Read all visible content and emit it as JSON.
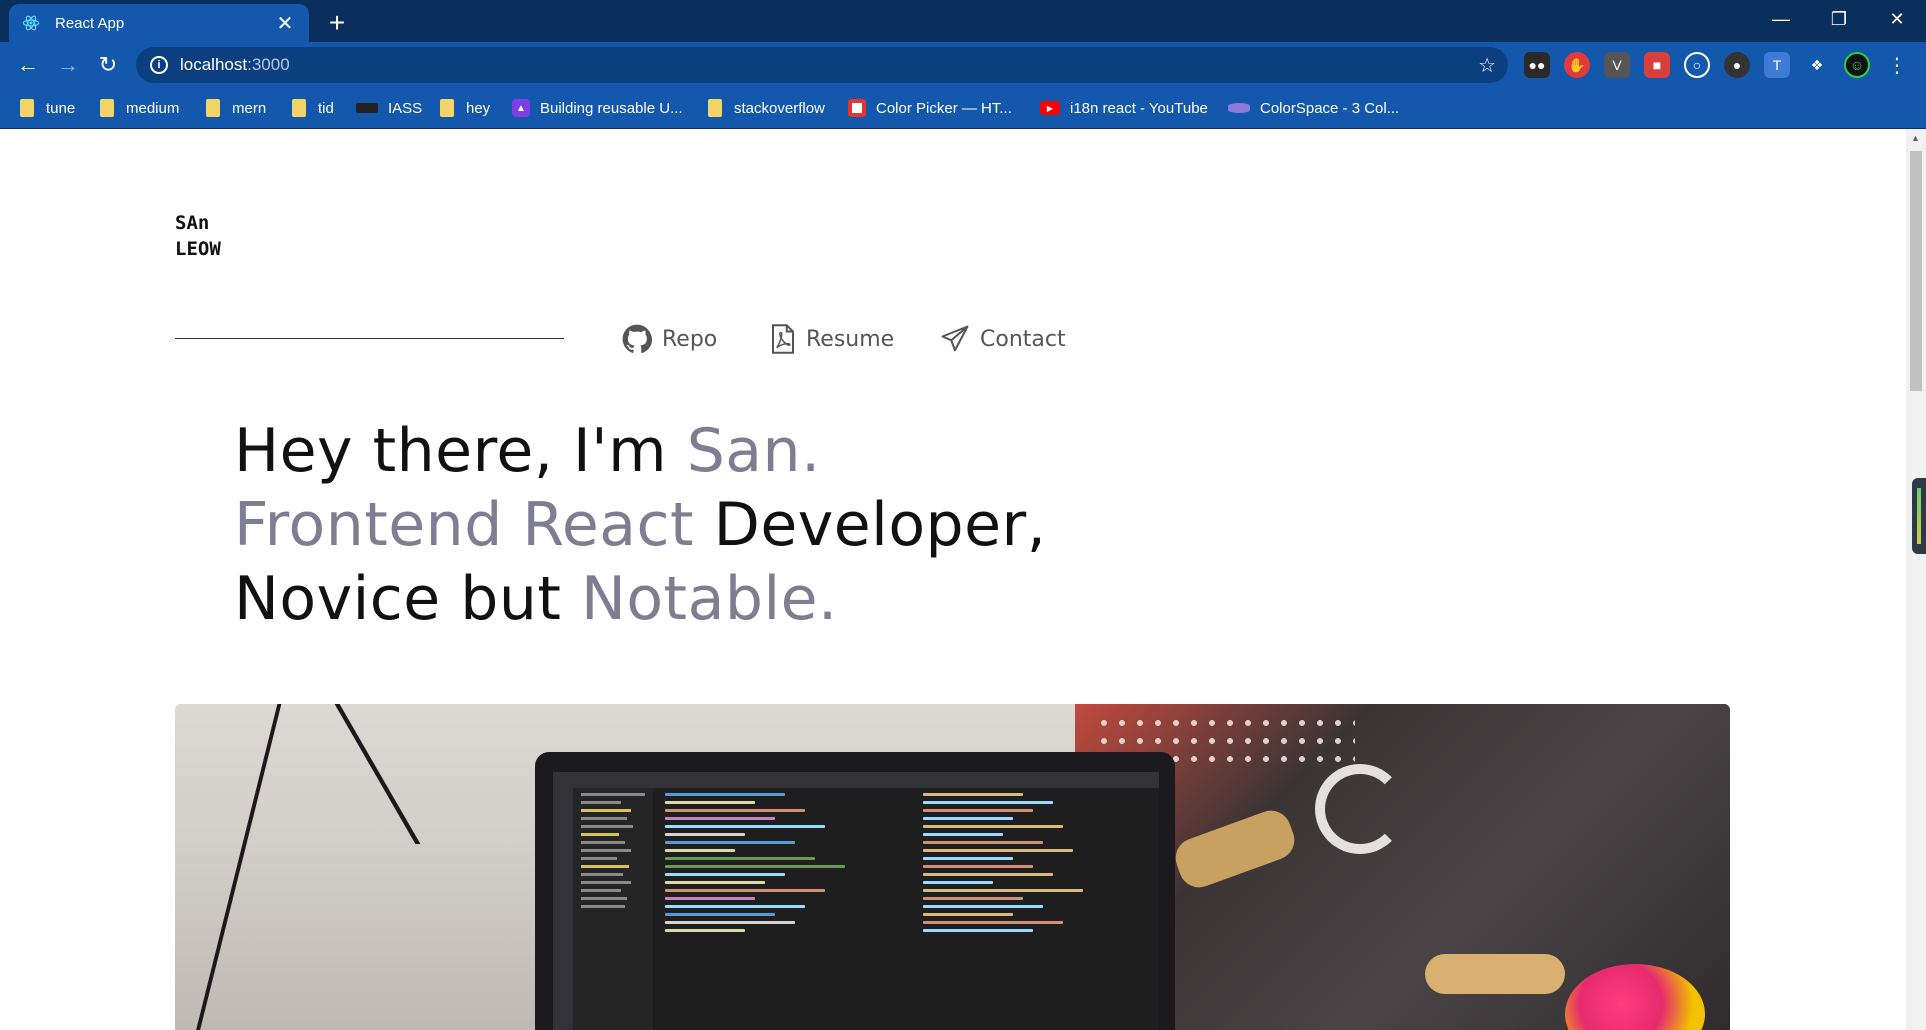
{
  "browser": {
    "tab_title": "React App",
    "tab_close": "✕",
    "new_tab": "+",
    "url_host": "localhost",
    "url_port": ":3000",
    "window_controls": {
      "minimize": "—",
      "restore": "❐",
      "close": "✕"
    },
    "bookmarks": [
      {
        "label": "tune",
        "kind": "folder"
      },
      {
        "label": "medium",
        "kind": "folder"
      },
      {
        "label": "mern",
        "kind": "folder"
      },
      {
        "label": "tid",
        "kind": "folder"
      },
      {
        "label": "IASS",
        "kind": "site"
      },
      {
        "label": "hey",
        "kind": "folder"
      },
      {
        "label": "Building reusable U...",
        "kind": "site"
      },
      {
        "label": "stackoverflow",
        "kind": "folder"
      },
      {
        "label": "Color Picker — HT...",
        "kind": "site"
      },
      {
        "label": "i18n react - YouTube",
        "kind": "site"
      },
      {
        "label": "ColorSpace - 3 Col...",
        "kind": "site"
      }
    ]
  },
  "page": {
    "logo_line1": "SAn",
    "logo_line2": "LEOW",
    "nav": [
      {
        "label": "Repo",
        "icon": "github-icon"
      },
      {
        "label": "Resume",
        "icon": "pdf-file-icon"
      },
      {
        "label": "Contact",
        "icon": "paper-plane-icon"
      }
    ],
    "hero": {
      "l1_a": "Hey there, I'm ",
      "l1_b": "San.",
      "l2_a": "Frontend React",
      "l2_b": " Developer,",
      "l3_a": "Novice but ",
      "l3_b": "Notable."
    },
    "colors": {
      "accent_text": "#7f7d92",
      "tab_active": "#1458ad",
      "tabstrip": "#0b2f5c"
    }
  }
}
